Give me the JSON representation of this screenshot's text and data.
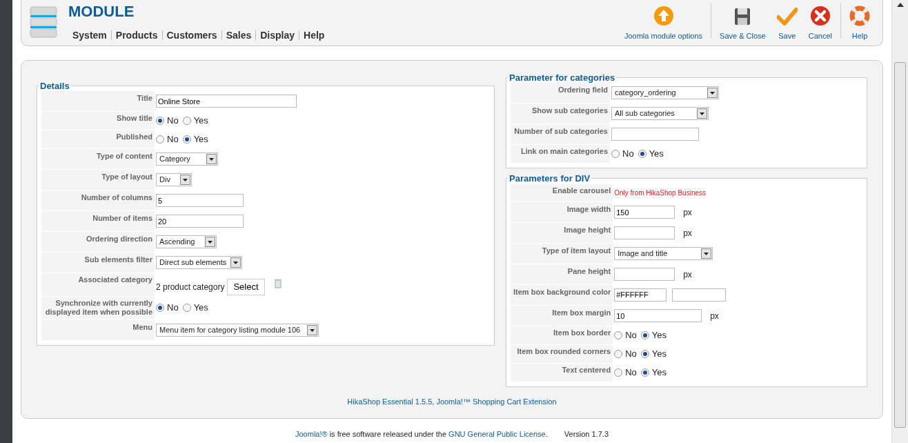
{
  "header": {
    "title": "MODULE",
    "menu": [
      "System",
      "Products",
      "Customers",
      "Sales",
      "Display",
      "Help"
    ]
  },
  "toolbar": [
    {
      "label": "Joomla module options",
      "kind": "options"
    },
    {
      "label": "Save & Close",
      "kind": "save_close"
    },
    {
      "label": "Save",
      "kind": "save"
    },
    {
      "label": "Cancel",
      "kind": "cancel"
    },
    {
      "label": "Help",
      "kind": "help"
    }
  ],
  "details": {
    "legend": "Details",
    "rows": [
      {
        "label": "Title",
        "kind": "text",
        "value": "Online Store"
      },
      {
        "label": "Show title",
        "kind": "radio",
        "options": [
          {
            "label": "No",
            "selected": true
          },
          {
            "label": "Yes",
            "selected": false
          }
        ]
      },
      {
        "label": "Published",
        "kind": "radio",
        "options": [
          {
            "label": "No",
            "selected": false
          },
          {
            "label": "Yes",
            "selected": true
          }
        ]
      },
      {
        "label": "Type of content",
        "kind": "select",
        "value": "Category"
      },
      {
        "label": "Type of layout",
        "kind": "select",
        "value": "Div"
      },
      {
        "label": "Number of columns",
        "kind": "text",
        "value": "5"
      },
      {
        "label": "Number of items",
        "kind": "text",
        "value": "20"
      },
      {
        "label": "Ordering direction",
        "kind": "select",
        "value": "Ascending"
      },
      {
        "label": "Sub elements filter",
        "kind": "select",
        "value": "Direct sub elements"
      },
      {
        "label": "Associated category",
        "kind": "category",
        "value": "2 product category",
        "button": "Select"
      },
      {
        "label": "Synchronize with currently displayed item when possible",
        "kind": "radio",
        "options": [
          {
            "label": "No",
            "selected": true
          },
          {
            "label": "Yes",
            "selected": false
          }
        ]
      },
      {
        "label": "Menu",
        "kind": "select",
        "value": "Menu item for category listing module 106"
      }
    ]
  },
  "categories": {
    "legend": "Parameter for categories",
    "rows": [
      {
        "label": "Ordering field",
        "kind": "select",
        "value": "category_ordering"
      },
      {
        "label": "Show sub categories",
        "kind": "select",
        "value": "All sub categories"
      },
      {
        "label": "Number of sub categories",
        "kind": "text"
      },
      {
        "label": "Link on main categories",
        "kind": "radio",
        "options": [
          {
            "label": "No",
            "selected": false
          },
          {
            "label": "Yes",
            "selected": true
          }
        ]
      }
    ]
  },
  "div_params": {
    "legend": "Parameters for DIV",
    "rows": [
      {
        "label": "Enable carousel",
        "kind": "note",
        "value": "Only from HikaShop Business"
      },
      {
        "label": "Image width",
        "kind": "text",
        "value": "150",
        "unit": "px"
      },
      {
        "label": "Image height",
        "kind": "text",
        "unit": "px"
      },
      {
        "label": "Type of item layout",
        "kind": "select",
        "value": "Image and title"
      },
      {
        "label": "Pane height",
        "kind": "text",
        "unit": "px"
      },
      {
        "label": "Item box background color",
        "kind": "color",
        "value": "#FFFFFF"
      },
      {
        "label": "Item box margin",
        "kind": "text",
        "value": "10",
        "unit": "px"
      },
      {
        "label": "Item box border",
        "kind": "radio",
        "options": [
          {
            "label": "No",
            "selected": false
          },
          {
            "label": "Yes",
            "selected": true
          }
        ]
      },
      {
        "label": "Item box rounded corners",
        "kind": "radio",
        "options": [
          {
            "label": "No",
            "selected": false
          },
          {
            "label": "Yes",
            "selected": true
          }
        ]
      },
      {
        "label": "Text centered",
        "kind": "radio",
        "options": [
          {
            "label": "No",
            "selected": false
          },
          {
            "label": "Yes",
            "selected": true
          }
        ]
      }
    ]
  },
  "credit": "HikaShop Essential 1.5.5, Joomla!™ Shopping Cart Extension",
  "footer": {
    "parts": [
      {
        "text": "Joomla!®",
        "kind": "link"
      },
      {
        "text": " is free software released under the ",
        "kind": "text"
      },
      {
        "text": "GNU General Public License",
        "kind": "link"
      },
      {
        "text": ".",
        "kind": "text"
      }
    ],
    "version": "Version 1.7.3"
  }
}
